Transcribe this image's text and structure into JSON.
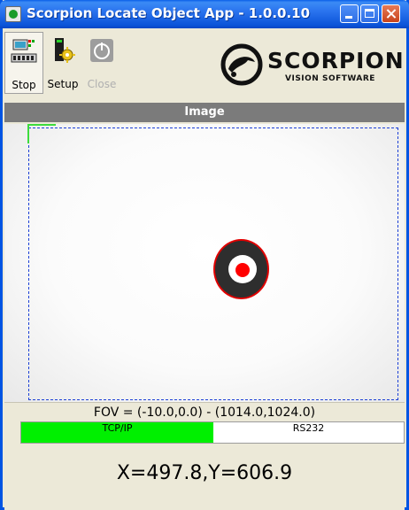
{
  "window": {
    "title": "Scorpion Locate Object App - 1.0.0.10",
    "controls": {
      "minimize": "minimize",
      "maximize": "maximize",
      "close": "close"
    }
  },
  "toolbar": {
    "buttons": [
      {
        "label": "Stop",
        "icon": "stop-icon",
        "enabled": true
      },
      {
        "label": "Setup",
        "icon": "setup-icon",
        "enabled": true
      },
      {
        "label": "Close",
        "icon": "power-icon",
        "enabled": false
      }
    ]
  },
  "logo": {
    "main": "SCORPION",
    "sub": "VISION SOFTWARE"
  },
  "image": {
    "header": "Image"
  },
  "fov": {
    "text": "FOV = (-10.0,0.0) - (1014.0,1024.0)"
  },
  "status": {
    "tcp": {
      "label": "TCP/IP",
      "color": "#00f000"
    },
    "rs232": {
      "label": "RS232",
      "color": "#ffffff"
    }
  },
  "result": {
    "text": "X=497.8,Y=606.9"
  }
}
